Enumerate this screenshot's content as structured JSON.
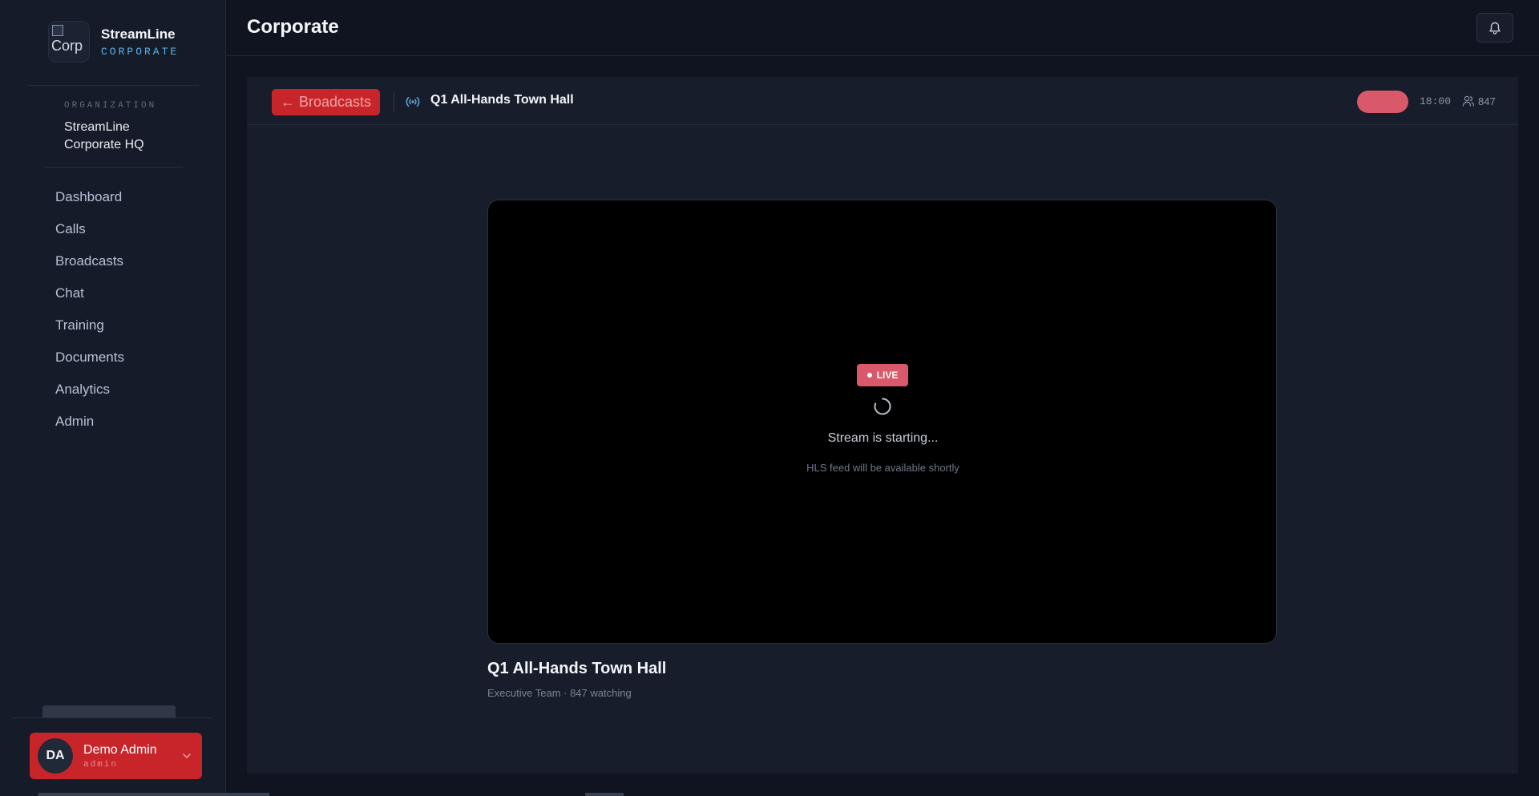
{
  "sidebar": {
    "brand": {
      "logo_alt": "Corp",
      "name": "StreamLine",
      "sub": "CORPORATE"
    },
    "organization": {
      "label": "ORGANIZATION",
      "name": "StreamLine Corporate HQ"
    },
    "nav": [
      {
        "label": "Dashboard"
      },
      {
        "label": "Calls"
      },
      {
        "label": "Broadcasts"
      },
      {
        "label": "Chat"
      },
      {
        "label": "Training"
      },
      {
        "label": "Documents"
      },
      {
        "label": "Analytics"
      },
      {
        "label": "Admin"
      }
    ],
    "user": {
      "initials": "DA",
      "name": "Demo Admin",
      "role": "admin"
    }
  },
  "header": {
    "title": "Corporate",
    "bell_icon": "bell-icon"
  },
  "toolbar": {
    "back_label": "← Broadcasts",
    "title": "Q1 All-Hands Town Hall",
    "timer": "18:00",
    "viewers": "847"
  },
  "player": {
    "badge": "LIVE",
    "status": "Stream is starting...",
    "sub": "HLS feed will be available shortly"
  },
  "video_info": {
    "title": "Q1 All-Hands Town Hall",
    "meta": "Executive Team · 847 watching"
  },
  "colors": {
    "accent_red": "#c8252b",
    "live_pink": "#d9596a",
    "brand_blue": "#5db3e8"
  }
}
